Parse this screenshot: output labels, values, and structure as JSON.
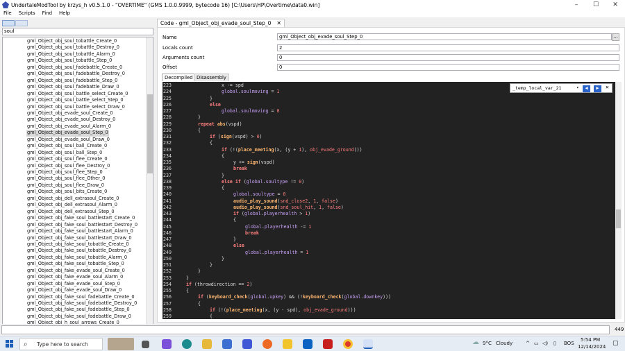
{
  "window": {
    "title": "UndertaleModTool by krzys_h v0.5.1.0 - \"OVERTIME\" (GMS 1.0.0.9999, bytecode 16) [C:\\Users\\HP\\Overtime\\data0.win]",
    "minimize": "–",
    "maximize": "☐",
    "close": "✕"
  },
  "menu": [
    "File",
    "Scripts",
    "Find",
    "Help"
  ],
  "search": {
    "value": "soul"
  },
  "tree": {
    "items": [
      "gml_Object_obj_soul_tobattle_Create_0",
      "gml_Object_obj_soul_tobattle_Destroy_0",
      "gml_Object_obj_soul_tobattle_Alarm_0",
      "gml_Object_obj_soul_tobattle_Step_0",
      "gml_Object_obj_soul_fadebattle_Create_0",
      "gml_Object_obj_soul_fadebattle_Destroy_0",
      "gml_Object_obj_soul_fadebattle_Step_0",
      "gml_Object_obj_soul_fadebattle_Draw_0",
      "gml_Object_obj_soul_battle_select_Create_0",
      "gml_Object_obj_soul_battle_select_Step_0",
      "gml_Object_obj_soul_battle_select_Draw_0",
      "gml_Object_obj_evade_soul_Create_0",
      "gml_Object_obj_evade_soul_Destroy_0",
      "gml_Object_obj_evade_soul_Alarm_0",
      "gml_Object_obj_evade_soul_Step_0",
      "gml_Object_obj_evade_soul_Draw_0",
      "gml_Object_obj_soul_ball_Create_0",
      "gml_Object_obj_soul_ball_Step_0",
      "gml_Object_obj_soul_flee_Create_0",
      "gml_Object_obj_soul_flee_Destroy_0",
      "gml_Object_obj_soul_flee_Step_0",
      "gml_Object_obj_soul_flee_Other_0",
      "gml_Object_obj_soul_flee_Draw_0",
      "gml_Object_obj_soul_bits_Create_0",
      "gml_Object_obj_dell_extrasoul_Create_0",
      "gml_Object_obj_dell_extrasoul_Alarm_0",
      "gml_Object_obj_dell_extrasoul_Step_0",
      "gml_Object_obj_fake_soul_battlestart_Create_0",
      "gml_Object_obj_fake_soul_battlestart_Destroy_0",
      "gml_Object_obj_fake_soul_battlestart_Alarm_0",
      "gml_Object_obj_fake_soul_battlestart_Draw_0",
      "gml_Object_obj_fake_soul_tobattle_Create_0",
      "gml_Object_obj_fake_soul_tobattle_Destroy_0",
      "gml_Object_obj_fake_soul_tobattle_Alarm_0",
      "gml_Object_obj_fake_soul_tobattle_Step_0",
      "gml_Object_obj_fake_evade_soul_Create_0",
      "gml_Object_obj_fake_evade_soul_Alarm_0",
      "gml_Object_obj_fake_evade_soul_Step_0",
      "gml_Object_obj_fake_evade_soul_Draw_0",
      "gml_Object_obj_fake_soul_fadebattle_Create_0",
      "gml_Object_obj_fake_soul_fadebattle_Destroy_0",
      "gml_Object_obj_fake_soul_fadebattle_Step_0",
      "gml_Object_obj_fake_soul_fadebattle_Draw_0",
      "gml_Object_obj_h_soul_arrows_Create_0"
    ],
    "selected_index": 14
  },
  "editor": {
    "tab_title": "Code - gml_Object_obj_evade_soul_Step_0",
    "tab_close": "✕",
    "fields": {
      "name_label": "Name",
      "name_value": "gml_Object_obj_evade_soul_Step_0",
      "locals_label": "Locals count",
      "locals_value": "2",
      "args_label": "Arguments count",
      "args_value": "0",
      "offset_label": "Offset",
      "offset_value": "0"
    },
    "browse_button": "...",
    "subtabs": [
      "Decompiled",
      "Disassembly"
    ],
    "find": {
      "value": "_temp_local_var_21",
      "dropdown": "▾",
      "prev": "◀",
      "next": "▶",
      "close": "✕"
    },
    "lines": [
      {
        "n": "223",
        "indent": 6,
        "t": "x -= spd"
      },
      {
        "n": "224",
        "indent": 6,
        "t": "global.soulmoving = 1"
      },
      {
        "n": "225",
        "indent": 4,
        "t": "}"
      },
      {
        "n": "226",
        "indent": 4,
        "t": "else"
      },
      {
        "n": "227",
        "indent": 6,
        "t": "global.soulmoving = 0"
      },
      {
        "n": "228",
        "indent": 2,
        "t": "}"
      },
      {
        "n": "229",
        "indent": 2,
        "t": "repeat abs(vspd)"
      },
      {
        "n": "230",
        "indent": 2,
        "t": "{"
      },
      {
        "n": "231",
        "indent": 4,
        "t": "if (sign(vspd) > 0)"
      },
      {
        "n": "232",
        "indent": 4,
        "t": "{"
      },
      {
        "n": "233",
        "indent": 6,
        "t": "if (!(place_meeting(x, (y + 1), obj_evade_ground)))"
      },
      {
        "n": "234",
        "indent": 6,
        "t": "{"
      },
      {
        "n": "235",
        "indent": 8,
        "t": "y += sign(vspd)"
      },
      {
        "n": "236",
        "indent": 8,
        "t": "break"
      },
      {
        "n": "237",
        "indent": 6,
        "t": "}"
      },
      {
        "n": "238",
        "indent": 6,
        "t": "else if (global.soultype != 0)"
      },
      {
        "n": "239",
        "indent": 6,
        "t": "{"
      },
      {
        "n": "240",
        "indent": 8,
        "t": "global.soultype = 0"
      },
      {
        "n": "241",
        "indent": 8,
        "t": "audio_play_sound(snd_close2, 1, false)"
      },
      {
        "n": "242",
        "indent": 8,
        "t": "audio_play_sound(snd_soul_hit, 1, false)"
      },
      {
        "n": "243",
        "indent": 8,
        "t": "if (global.playerhealth > 1)"
      },
      {
        "n": "244",
        "indent": 8,
        "t": "{"
      },
      {
        "n": "245",
        "indent": 10,
        "t": "global.playerhealth -= 1"
      },
      {
        "n": "246",
        "indent": 10,
        "t": "break"
      },
      {
        "n": "247",
        "indent": 8,
        "t": "}"
      },
      {
        "n": "248",
        "indent": 8,
        "t": "else"
      },
      {
        "n": "249",
        "indent": 10,
        "t": "global.playerhealth = 1"
      },
      {
        "n": "250",
        "indent": 6,
        "t": "}"
      },
      {
        "n": "251",
        "indent": 4,
        "t": "}"
      },
      {
        "n": "252",
        "indent": 2,
        "t": "}"
      },
      {
        "n": "253",
        "indent": 0,
        "t": "}"
      },
      {
        "n": "254",
        "indent": 0,
        "t": "if (throwdirection == 2)"
      },
      {
        "n": "255",
        "indent": 0,
        "t": "{"
      },
      {
        "n": "256",
        "indent": 2,
        "t": "if (keyboard_check(global.upkey) && (!keyboard_check(global.downkey)))"
      },
      {
        "n": "257",
        "indent": 2,
        "t": "{"
      },
      {
        "n": "258",
        "indent": 4,
        "t": "if (!(place_meeting(x, (y - spd), obj_evade_ground)))"
      },
      {
        "n": "259",
        "indent": 4,
        "t": "{"
      }
    ]
  },
  "status": {
    "value": "",
    "count": "449"
  },
  "taskbar": {
    "search_placeholder": "Type here to search",
    "weather_temp": "9°C",
    "weather_text": "Cloudy",
    "language": "BOS",
    "time": "5:54 PM",
    "date": "12/14/2024",
    "icons": [
      "task-view-icon",
      "copilot-icon",
      "edge-icon",
      "file-explorer-icon",
      "store-icon",
      "media-player-icon",
      "firefox-icon",
      "game-icon",
      "outlook-icon",
      "red-app-icon",
      "chrome-icon",
      "undertalemodtool-icon"
    ],
    "colors": {
      "taskbar": "#e6ecf3",
      "accent": "#1e5fb8"
    }
  }
}
